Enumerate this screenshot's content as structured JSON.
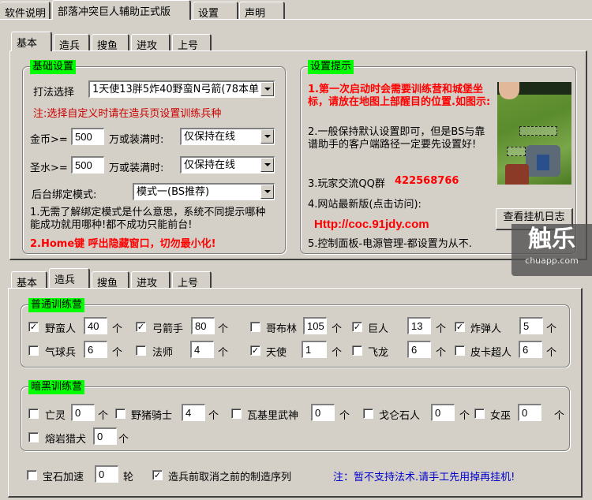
{
  "top_tabs": [
    "软件说明",
    "部落冲突巨人辅助正式版",
    "设置",
    "声明"
  ],
  "sub_tabs": [
    "基本",
    "造兵",
    "搜鱼",
    "进攻",
    "上号"
  ],
  "basic": {
    "group_title": "基础设置",
    "strategy_label": "打法选择",
    "strategy_value": "1天使13胖5炸40野蛮N弓箭(78本单",
    "note": "注:选择自定义时请在造兵页设置训练兵种",
    "gold_label": "金币>=",
    "gold_value": "500",
    "gold_suffix": "万或装满时:",
    "gold_action": "仅保持在线",
    "elixir_label": "圣水>=",
    "elixir_value": "500",
    "elixir_suffix": "万或装满时:",
    "elixir_action": "仅保持在线",
    "bind_label": "后台绑定模式:",
    "bind_value": "模式一(BS推荐)",
    "tip1": "1.无需了解绑定模式是什么意思，系统不同提示哪种能成功就用哪种!都不成功只能前台!",
    "tip2": "2.Home键 呼出隐藏窗口，切勿最小化!"
  },
  "hints": {
    "group_title": "设置提示",
    "hint1": "1.第一次启动时会需要训练营和城堡坐标，请放在地图上部醒目的位置.如图示:",
    "hint2": "2.一般保持默认设置即可，但是BS与靠谱助手的客户端路径一定要先设置好!",
    "hint3_label": "3.玩家交流QQ群",
    "hint3_value": "422568766",
    "hint4": "4.网站最新版(点击访问):",
    "url": "Http://coc.91jdy.com",
    "hint5": "5.控制面板-电源管理-都设置为从不.",
    "log_button": "查看挂机日志"
  },
  "watermark": {
    "brand": "触乐",
    "site": "chuapp.com"
  },
  "troops": {
    "normal_title": "普通训练营",
    "unit": "个",
    "normal": [
      {
        "name": "野蛮人",
        "checked": true,
        "count": "40"
      },
      {
        "name": "弓箭手",
        "checked": true,
        "count": "80"
      },
      {
        "name": "哥布林",
        "checked": false,
        "count": "105"
      },
      {
        "name": "巨人",
        "checked": true,
        "count": "13"
      },
      {
        "name": "炸弹人",
        "checked": true,
        "count": "5"
      },
      {
        "name": "气球兵",
        "checked": false,
        "count": "6"
      },
      {
        "name": "法师",
        "checked": false,
        "count": "4"
      },
      {
        "name": "天使",
        "checked": true,
        "count": "1"
      },
      {
        "name": "飞龙",
        "checked": false,
        "count": "6"
      },
      {
        "name": "皮卡超人",
        "checked": false,
        "count": "6"
      }
    ],
    "dark_title": "暗黑训练营",
    "dark": [
      {
        "name": "亡灵",
        "checked": false,
        "count": "0"
      },
      {
        "name": "野猪骑士",
        "checked": false,
        "count": "4"
      },
      {
        "name": "瓦基里武神",
        "checked": false,
        "count": "0"
      },
      {
        "name": "戈仑石人",
        "checked": false,
        "count": "0"
      },
      {
        "name": "女巫",
        "checked": false,
        "count": "0"
      },
      {
        "name": "熔岩猎犬",
        "checked": false,
        "count": "0"
      }
    ],
    "gem_label": "宝石加速",
    "gem_checked": false,
    "gem_value": "0",
    "gem_unit": "轮",
    "cancel_label": "造兵前取消之前的制造序列",
    "cancel_checked": true,
    "spell_note": "注：暂不支持法术.请手工先用掉再挂机!"
  }
}
